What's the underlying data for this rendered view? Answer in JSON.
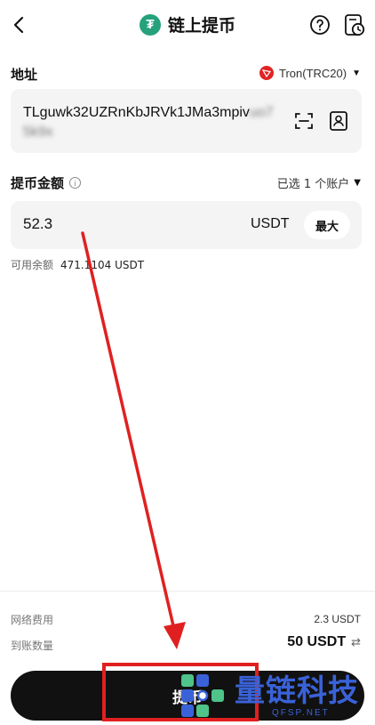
{
  "header": {
    "title": "链上提币",
    "back_icon": "chevron-left-icon",
    "help_icon": "question-circle-icon",
    "history_icon": "history-icon"
  },
  "address": {
    "label": "地址",
    "network": "Tron(TRC20)",
    "value_visible": "TLguwk32UZRnKbJRVk1JMa3mpiv",
    "value_blurred": "uo75k9x"
  },
  "amount": {
    "label": "提币金额",
    "accounts_selected": "已选 1 个账户",
    "value": "52.3",
    "unit": "USDT",
    "max_label": "最大",
    "available_label": "可用余额",
    "available_value": "471.1104 USDT"
  },
  "footer": {
    "fee_label": "网络费用",
    "fee_value": "2.3 USDT",
    "receive_label": "到账数量",
    "receive_value": "50 USDT",
    "submit_label": "提币"
  },
  "watermark": {
    "main": "量链科技",
    "sub": "QFSP.NET"
  },
  "colors": {
    "tether": "#26a17b",
    "tron": "#e02424",
    "annotation": "#e02020",
    "watermark": "#3a62d8"
  }
}
